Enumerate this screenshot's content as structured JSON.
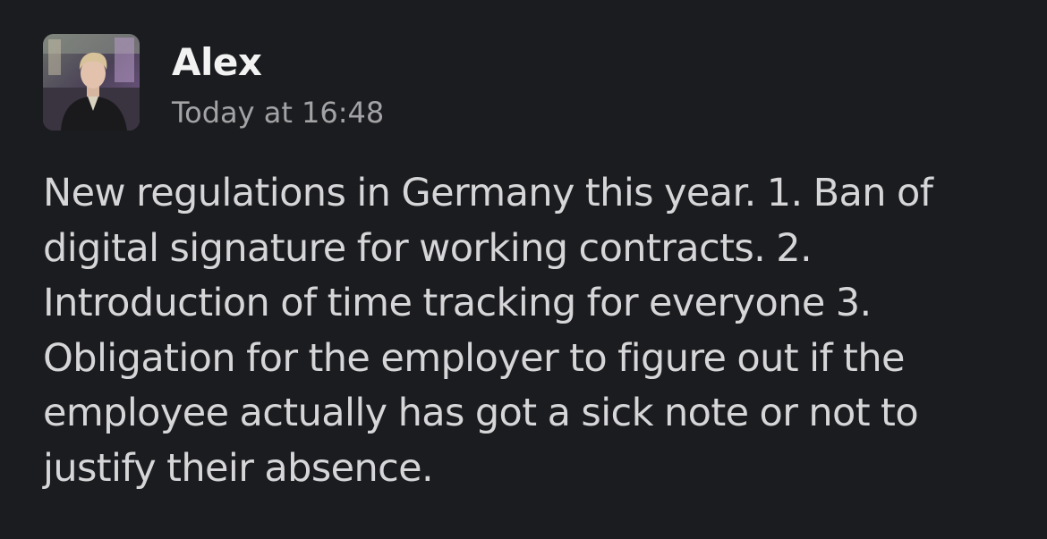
{
  "message": {
    "sender": "Alex",
    "timestamp": "Today at 16:48",
    "avatar_icon": "user-photo-avatar",
    "text": "New regulations in Germany this year. 1. Ban of digital signature for working contracts. 2. Introduction of time tracking for everyone 3. Obligation for the employer to figure out if the employee actually has got a sick note or not to justify their absence."
  },
  "colors": {
    "background": "#1b1c1f",
    "sender": "#f2f2f2",
    "timestamp": "#a3a3a6",
    "text": "#d6d6d8"
  }
}
